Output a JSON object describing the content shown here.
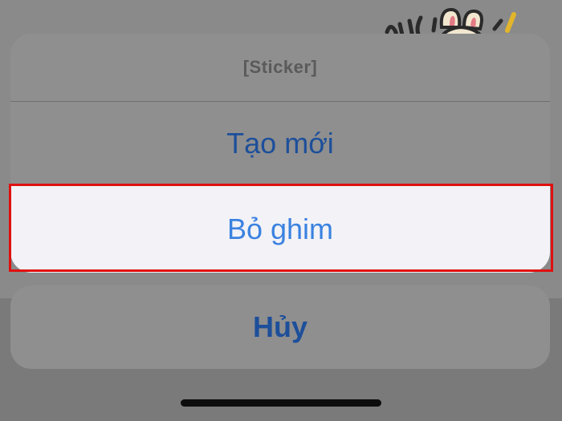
{
  "sheet": {
    "title": "[Sticker]",
    "actions": [
      {
        "label": "Tạo mới"
      },
      {
        "label": "Bỏ ghim"
      }
    ],
    "cancel_label": "Hủy"
  },
  "sticker": {
    "icon": "bunny-sticker-icon"
  },
  "colors": {
    "action_text": "#1d4f9a",
    "highlight_border": "#e01010",
    "selected_bg": "#f2f2f7",
    "selected_text": "#3b82e0"
  }
}
